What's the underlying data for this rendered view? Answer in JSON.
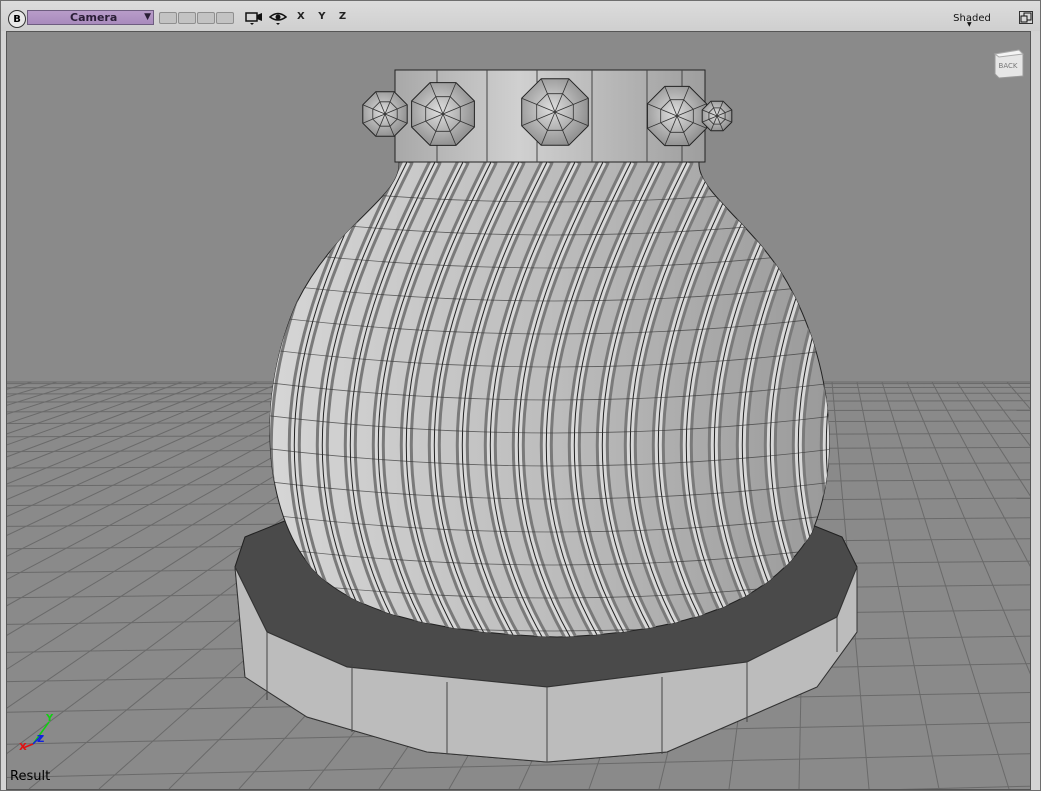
{
  "toolbar": {
    "b_label": "B",
    "camera_label": "Camera",
    "camera_arrow": "▼",
    "axes_label": "X Y Z",
    "shading_label": "Shaded",
    "shading_arrow": "▼"
  },
  "viewport": {
    "view_cube_label": "BACK",
    "axis_x": "X",
    "axis_y": "Y",
    "axis_z": "Z",
    "render_label": "Result"
  },
  "colors": {
    "camera_accent": "#b89cc9",
    "viewport_bg": "#8a8a8a",
    "grid_line": "#6a6a6a",
    "axis_x": "#e01010",
    "axis_y": "#10d010",
    "axis_z": "#1020e0"
  },
  "icons": [
    "camera-icon",
    "eye-icon",
    "maximize-icon",
    "view-cube-icon",
    "axis-gizmo-icon"
  ]
}
